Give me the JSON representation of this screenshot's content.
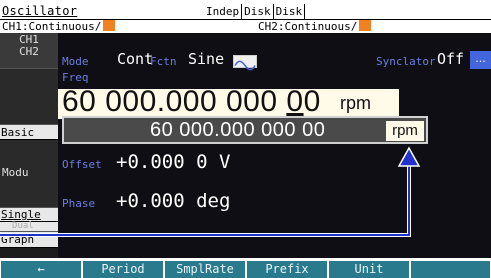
{
  "title": "Oscillator",
  "indicators": [
    "Indep",
    "Disk",
    "Disk"
  ],
  "channel_status": {
    "ch1": "CH1:Continuous/",
    "ch2": "CH2:Continuous/"
  },
  "left_tabs": {
    "ch1": "CH1",
    "ch2": "CH2",
    "basic": "Basic",
    "modu": "Modu",
    "single": "Single",
    "dual": "Dual",
    "graph": "Graph"
  },
  "mode": {
    "label": "Mode",
    "value": "Cont"
  },
  "fctn": {
    "label": "Fctn",
    "value": "Sine",
    "icon": "sine-wave-icon"
  },
  "synclator": {
    "label": "Synclator",
    "value": "Off",
    "more": "..."
  },
  "freq": {
    "label": "Freq",
    "value_pre": "60 000.000 000 ",
    "value_cursor": "0",
    "value_post": "0",
    "unit": "rpm"
  },
  "entry": {
    "value": "60 000.000 000 00",
    "unit": "rpm"
  },
  "offset": {
    "label": "Offset",
    "value": "+0.000 0 V"
  },
  "phase": {
    "label": "Phase",
    "value": "+0.000 deg"
  },
  "function_keys": [
    "←",
    "Period",
    "SmplRate",
    "Prefix",
    "Unit",
    ""
  ],
  "colors": {
    "panel": "#0e0e14",
    "label_blue": "#6b7fe0",
    "fkey_teal": "#2a7a8e",
    "status_orange": "#f08020",
    "arrow_blue": "#2233cc"
  }
}
